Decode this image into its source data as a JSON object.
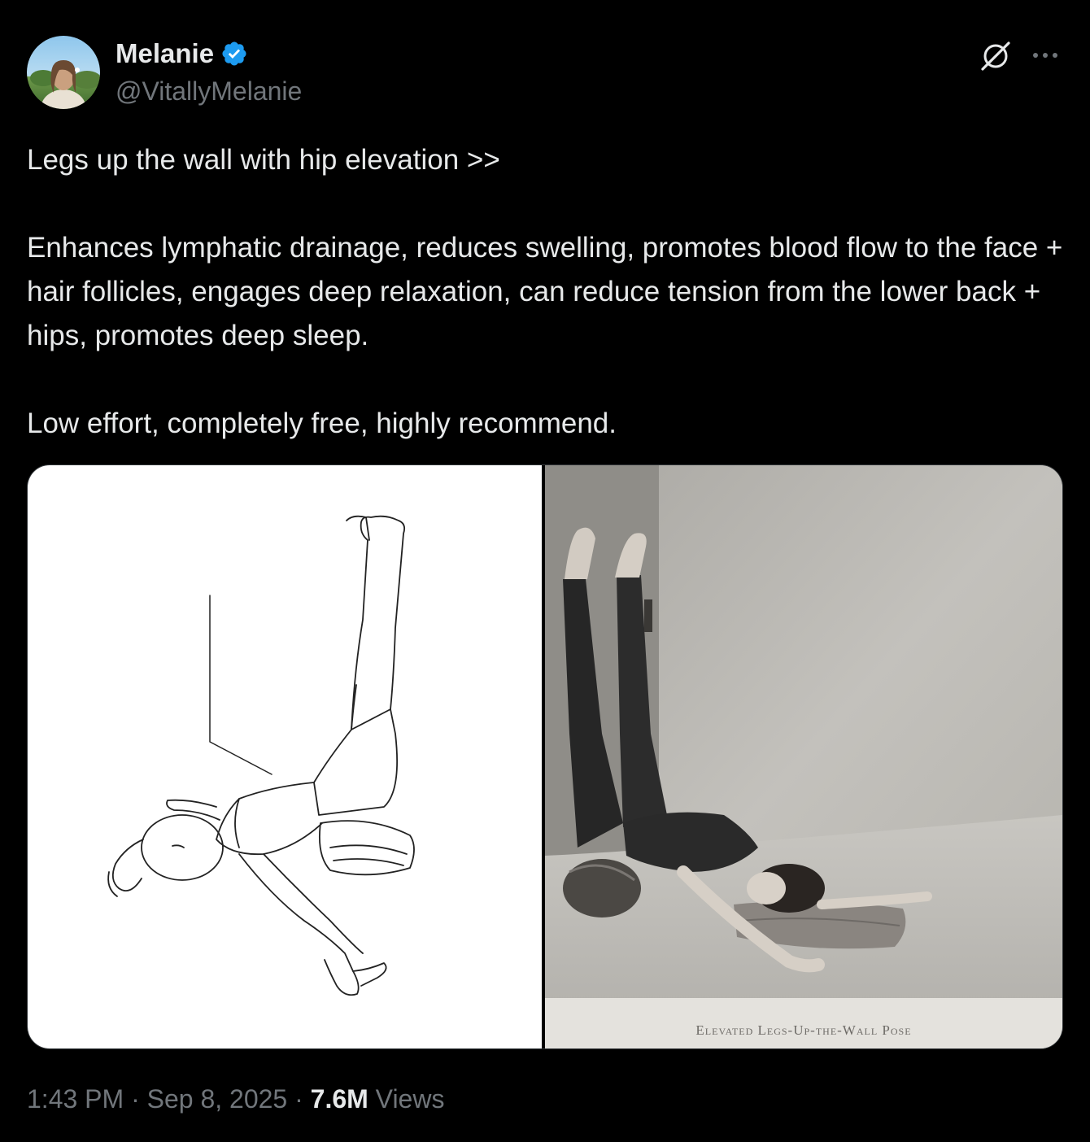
{
  "author": {
    "name": "Melanie",
    "handle": "@VitallyMelanie",
    "verified": true,
    "avatar_icon": "profile-photo",
    "verified_color": "#1d9bf0"
  },
  "header_icons": [
    "grok-icon",
    "more-horizontal-icon"
  ],
  "tweet": {
    "paragraphs": [
      "Legs up the wall with hip elevation >>",
      "Enhances lymphatic drainage, reduces swelling, promotes blood flow to the face + hair follicles, engages deep relaxation, can reduce tension from the lower back + hips, promotes deep sleep.",
      "Low effort, completely free, highly recommend."
    ]
  },
  "media": {
    "left_image": "line-drawing-legs-up-wall-pose",
    "right_image": "photo-elevated-legs-up-wall-pose",
    "right_caption": "Elevated Legs-Up-the-Wall Pose"
  },
  "meta": {
    "time": "1:43 PM",
    "separator": "·",
    "date": "Sep 8, 2025",
    "views_count": "7.6M",
    "views_label": "Views"
  },
  "colors": {
    "background": "#000000",
    "text_primary": "#e7e9ea",
    "text_secondary": "#71767b",
    "border": "#2f3336"
  }
}
